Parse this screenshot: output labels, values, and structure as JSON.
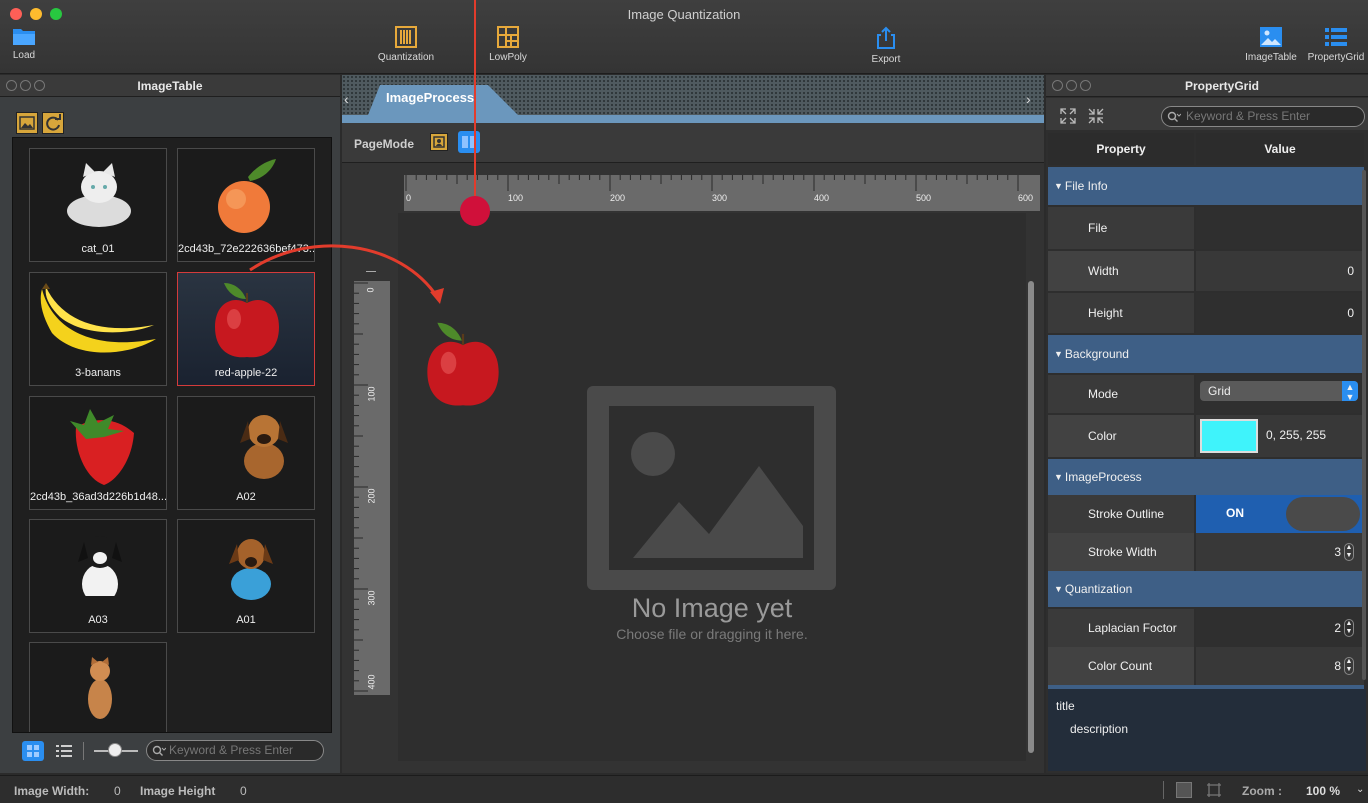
{
  "window": {
    "title": "Image Quantization"
  },
  "toolbar": {
    "load": "Load",
    "quantization": "Quantization",
    "lowpoly": "LowPoly",
    "export": "Export",
    "imagetable": "ImageTable",
    "propertygrid": "PropertyGrid"
  },
  "left_panel": {
    "title": "ImageTable",
    "items": [
      {
        "label": "cat_01"
      },
      {
        "label": "2cd43b_72e222636bef473..."
      },
      {
        "label": "3-banans"
      },
      {
        "label": "red-apple-22"
      },
      {
        "label": "2cd43b_36ad3d226b1d48..."
      },
      {
        "label": "A02"
      },
      {
        "label": "A03"
      },
      {
        "label": "A01"
      },
      {
        "label": ""
      }
    ],
    "search_placeholder": "Keyword & Press Enter"
  },
  "center_panel": {
    "tab": "ImageProcess",
    "pagemode_label": "PageMode",
    "ruler_h": [
      "0",
      "100",
      "200",
      "300",
      "400",
      "500",
      "600"
    ],
    "ruler_v": [
      "0",
      "100",
      "200",
      "300",
      "400"
    ],
    "empty_title": "No Image yet",
    "empty_sub": "Choose file or dragging it here."
  },
  "right_panel": {
    "title": "PropertyGrid",
    "search_placeholder": "Keyword & Press Enter",
    "col_property": "Property",
    "col_value": "Value",
    "sections": {
      "file_info": "File Info",
      "background": "Background",
      "imageprocess": "ImageProcess",
      "quantization": "Quantization"
    },
    "props": {
      "file": {
        "label": "File",
        "value": ""
      },
      "width": {
        "label": "Width",
        "value": "0"
      },
      "height": {
        "label": "Height",
        "value": "0"
      },
      "mode": {
        "label": "Mode",
        "value": "Grid"
      },
      "color": {
        "label": "Color",
        "value": "0, 255, 255",
        "swatch": "#3ff3fb"
      },
      "stroke_outline": {
        "label": "Stroke Outline",
        "value": "ON"
      },
      "stroke_width": {
        "label": "Stroke Width",
        "value": "3"
      },
      "laplacian": {
        "label": "Laplacian Foctor",
        "value": "2"
      },
      "color_count": {
        "label": "Color Count",
        "value": "8"
      }
    },
    "desc_title": "title",
    "desc_text": "description"
  },
  "status": {
    "image_width_label": "Image Width:",
    "image_width": "0",
    "image_height_label": "Image Height",
    "image_height": "0",
    "zoom_label": "Zoom :",
    "zoom": "100 %"
  },
  "colors": {
    "accent": "#3e5f86",
    "selection": "#d43b3b",
    "annotation": "#e23c2c"
  }
}
